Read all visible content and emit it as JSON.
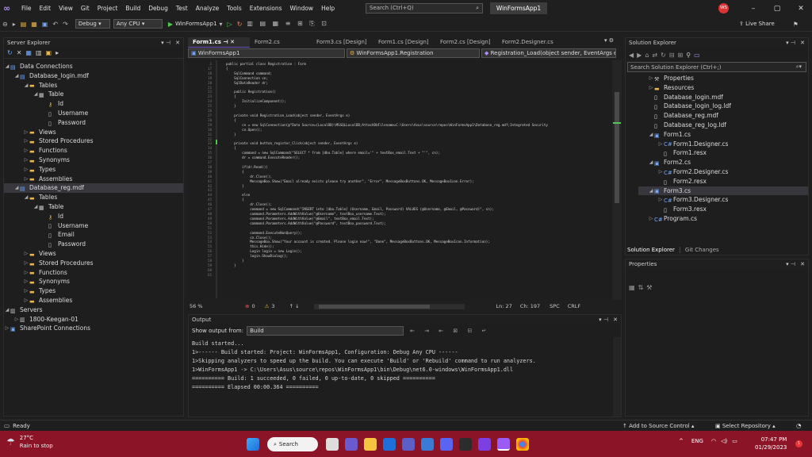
{
  "menubar": {
    "items": [
      "File",
      "Edit",
      "View",
      "Git",
      "Project",
      "Build",
      "Debug",
      "Test",
      "Analyze",
      "Tools",
      "Extensions",
      "Window",
      "Help"
    ],
    "search_placeholder": "Search (Ctrl+Q)",
    "app_title": "WinFormsApp1",
    "avatar": "WS"
  },
  "toolbar": {
    "config": "Debug",
    "platform": "Any CPU",
    "run_label": "WinFormsApp1",
    "live_share": "Live Share"
  },
  "server_explorer": {
    "title": "Server Explorer",
    "items": [
      {
        "label": "Data Connections",
        "indent": 0,
        "arrow": "◢",
        "icon": "db"
      },
      {
        "label": "Database_login.mdf",
        "indent": 1,
        "arrow": "◢",
        "icon": "db"
      },
      {
        "label": "Tables",
        "indent": 2,
        "arrow": "◢",
        "icon": "folder"
      },
      {
        "label": "Table",
        "indent": 3,
        "arrow": "◢",
        "icon": "table"
      },
      {
        "label": "Id",
        "indent": 4,
        "arrow": "",
        "icon": "key"
      },
      {
        "label": "Username",
        "indent": 4,
        "arrow": "",
        "icon": "col"
      },
      {
        "label": "Password",
        "indent": 4,
        "arrow": "",
        "icon": "col"
      },
      {
        "label": "Views",
        "indent": 2,
        "arrow": "▷",
        "icon": "folder"
      },
      {
        "label": "Stored Procedures",
        "indent": 2,
        "arrow": "▷",
        "icon": "folder"
      },
      {
        "label": "Functions",
        "indent": 2,
        "arrow": "▷",
        "icon": "folder"
      },
      {
        "label": "Synonyms",
        "indent": 2,
        "arrow": "▷",
        "icon": "folder"
      },
      {
        "label": "Types",
        "indent": 2,
        "arrow": "▷",
        "icon": "folder"
      },
      {
        "label": "Assemblies",
        "indent": 2,
        "arrow": "▷",
        "icon": "folder"
      },
      {
        "label": "Database_reg.mdf",
        "indent": 1,
        "arrow": "◢",
        "icon": "db",
        "selected": true
      },
      {
        "label": "Tables",
        "indent": 2,
        "arrow": "◢",
        "icon": "folder"
      },
      {
        "label": "Table",
        "indent": 3,
        "arrow": "◢",
        "icon": "table"
      },
      {
        "label": "Id",
        "indent": 4,
        "arrow": "",
        "icon": "key"
      },
      {
        "label": "Username",
        "indent": 4,
        "arrow": "",
        "icon": "col"
      },
      {
        "label": "Email",
        "indent": 4,
        "arrow": "",
        "icon": "col"
      },
      {
        "label": "Password",
        "indent": 4,
        "arrow": "",
        "icon": "col"
      },
      {
        "label": "Views",
        "indent": 2,
        "arrow": "▷",
        "icon": "folder"
      },
      {
        "label": "Stored Procedures",
        "indent": 2,
        "arrow": "▷",
        "icon": "folder"
      },
      {
        "label": "Functions",
        "indent": 2,
        "arrow": "▷",
        "icon": "folder"
      },
      {
        "label": "Synonyms",
        "indent": 2,
        "arrow": "▷",
        "icon": "folder"
      },
      {
        "label": "Types",
        "indent": 2,
        "arrow": "▷",
        "icon": "folder"
      },
      {
        "label": "Assemblies",
        "indent": 2,
        "arrow": "▷",
        "icon": "folder"
      },
      {
        "label": "Servers",
        "indent": 0,
        "arrow": "◢",
        "icon": "server"
      },
      {
        "label": "1800-Keegan-01",
        "indent": 1,
        "arrow": "▷",
        "icon": "server"
      },
      {
        "label": "SharePoint Connections",
        "indent": 0,
        "arrow": "▷",
        "icon": "sp"
      }
    ]
  },
  "editor": {
    "tabs": [
      "Form1.cs",
      "Form2.cs",
      "Form3.cs [Design]",
      "Form1.cs [Design]",
      "Form2.cs [Design]",
      "Form2.Designer.cs"
    ],
    "nav_project": "WinFormsApp1",
    "nav_class": "WinFormsApp1.Registration",
    "nav_member": "Registration_Load(object sender, EventArgs e)",
    "line_numbers": "1\n17\n18\n19\n20\n21\n22\n23\n24\n25\n26\n27\n28\n29\n30\n31\n32\n33\n34\n35\n36\n37\n38\n39\n40\n41\n42\n43\n44\n45\n46\n47\n48\n49\n50\n51\n52\n53\n54\n55\n56\n57\n58\n59\n60\n61",
    "code": "public partial class Registration : Form\n{\n    SqlCommand command;\n    SqlConnection cn;\n    SqlDataReader dr;\n\n    public Registration()\n    {\n        InitializeComponent();\n    }\n\n    private void Registration_Load(object sender, EventArgs e)\n    {\n        cn = new SqlConnection(@\"Data Source=(LocalDB)\\MSSQLLocalDB;AttachDbFilename=C:\\Users\\Asus\\source\\repos\\WinFormsApp1\\Database_reg.mdf;Integrated Security\n        cn.Open();\n    }\n\n    private void button_register_Click(object sender, EventArgs e)\n    {\n        command = new SqlCommand(\"SELECT * from [dbo.Table] where email='\" + textBox_email.Text + \"'\", cn);\n        dr = command.ExecuteReader();\n\n        if(dr.Read())\n        {\n            dr.Close();\n            MessageBox.Show(\"Email already exists please try another\", \"Error\", MessageBoxButtons.OK, MessageBoxIcon.Error);\n        }\n\n        else\n        {\n            dr.Close();\n            command = new SqlCommand(\"INSERT into [dbo.Table] (Username, Email, Password) VALUES (@Username, @Email, @Password)\", cn);\n            command.Parameters.AddWithValue(\"@Username\", textBox_username.Text);\n            command.Parameters.AddWithValue(\"@Email\", textBox_email.Text);\n            command.Parameters.AddWithValue(\"@Password\", textBox_password.Text);\n\n            command.ExecuteNonQuery();\n            cn.Close();\n            MessageBox.Show(\"Your account is created. Please login now!\", \"Done\", MessageBoxButtons.OK, MessageBoxIcon.Information);\n            this.Hide();\n            Login login = new Login();\n            login.ShowDialog();\n        }\n    }",
    "zoom": "56 %",
    "errors": "0",
    "warnings": "3",
    "ln": "Ln: 27",
    "ch": "Ch: 197",
    "spc": "SPC",
    "crlf": "CRLF"
  },
  "output": {
    "title": "Output",
    "show_from_label": "Show output from:",
    "source": "Build",
    "text": "Build started...\n1>------ Build started: Project: WinFormsApp1, Configuration: Debug Any CPU ------\n1>Skipping analyzers to speed up the build. You can execute 'Build' or 'Rebuild' command to run analyzers.\n1>WinFormsApp1 -> C:\\Users\\Asus\\source\\repos\\WinFormsApp1\\bin\\Debug\\net6.0-windows\\WinFormsApp1.dll\n========== Build: 1 succeeded, 0 failed, 0 up-to-date, 0 skipped ==========\n========== Elapsed 00:00.364 =========="
  },
  "solution_explorer": {
    "title": "Solution Explorer",
    "search_placeholder": "Search Solution Explorer (Ctrl+;)",
    "items": [
      {
        "label": "Properties",
        "indent": 1,
        "arrow": "▷",
        "icon": "wrench"
      },
      {
        "label": "Resources",
        "indent": 1,
        "arrow": "▷",
        "icon": "folder"
      },
      {
        "label": "Database_login.mdf",
        "indent": 1,
        "arrow": "",
        "icon": "file"
      },
      {
        "label": "Database_login_log.ldf",
        "indent": 1,
        "arrow": "",
        "icon": "file"
      },
      {
        "label": "Database_reg.mdf",
        "indent": 1,
        "arrow": "",
        "icon": "file"
      },
      {
        "label": "Database_reg_log.ldf",
        "indent": 1,
        "arrow": "",
        "icon": "file"
      },
      {
        "label": "Form1.cs",
        "indent": 1,
        "arrow": "◢",
        "icon": "form"
      },
      {
        "label": "Form1.Designer.cs",
        "indent": 2,
        "arrow": "▷",
        "icon": "cs"
      },
      {
        "label": "Form1.resx",
        "indent": 2,
        "arrow": "",
        "icon": "file"
      },
      {
        "label": "Form2.cs",
        "indent": 1,
        "arrow": "◢",
        "icon": "form"
      },
      {
        "label": "Form2.Designer.cs",
        "indent": 2,
        "arrow": "▷",
        "icon": "cs"
      },
      {
        "label": "Form2.resx",
        "indent": 2,
        "arrow": "",
        "icon": "file"
      },
      {
        "label": "Form3.cs",
        "indent": 1,
        "arrow": "◢",
        "icon": "form",
        "selected": true
      },
      {
        "label": "Form3.Designer.cs",
        "indent": 2,
        "arrow": "▷",
        "icon": "cs"
      },
      {
        "label": "Form3.resx",
        "indent": 2,
        "arrow": "",
        "icon": "file"
      },
      {
        "label": "Program.cs",
        "indent": 1,
        "arrow": "▷",
        "icon": "cs"
      }
    ],
    "bottom_tabs": [
      "Solution Explorer",
      "Git Changes"
    ]
  },
  "properties": {
    "title": "Properties"
  },
  "statusbar": {
    "ready": "Ready",
    "source_control": "Add to Source Control",
    "repo": "Select Repository"
  },
  "taskbar": {
    "weather_temp": "27°C",
    "weather_desc": "Rain to stop",
    "search": "Search",
    "lang": "ENG",
    "time": "07:47 PM",
    "date": "01/29/2023"
  }
}
